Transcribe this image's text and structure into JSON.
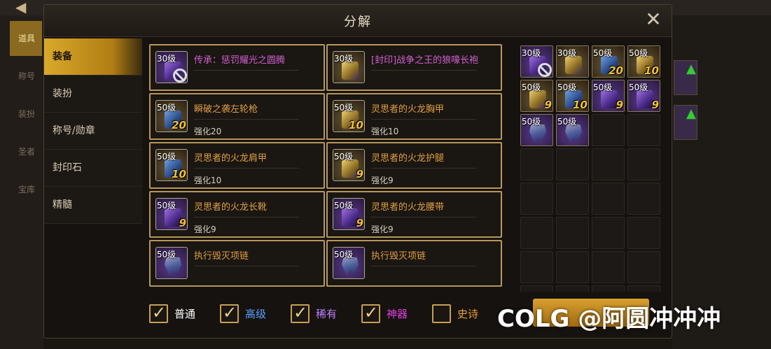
{
  "background": {
    "side_tabs": [
      "道具",
      "称号",
      "装扮",
      "圣者",
      "宝库"
    ]
  },
  "dialog": {
    "title": "分解",
    "close_label": "✕"
  },
  "categories": [
    {
      "label": "装备",
      "active": true
    },
    {
      "label": "装扮",
      "active": false
    },
    {
      "label": "称号/勋章",
      "active": false
    },
    {
      "label": "封印石",
      "active": false
    },
    {
      "label": "精髓",
      "active": false
    }
  ],
  "items": [
    {
      "level": "30级",
      "name": "传承：惩罚耀光之圆腾",
      "enhance": "",
      "badge": "",
      "rarity": "legend",
      "icon": "totem-icon",
      "banned": true
    },
    {
      "level": "30级",
      "name": "[封印]战争之王的狼嚎长袍",
      "enhance": "",
      "badge": "",
      "rarity": "legend",
      "icon": "robe-icon",
      "banned": false
    },
    {
      "level": "50级",
      "name": "瞬破之袭左轮枪",
      "enhance": "强化20",
      "badge": "20",
      "rarity": "rare",
      "icon": "revolver-icon",
      "banned": false
    },
    {
      "level": "50级",
      "name": "灵思者的火龙胸甲",
      "enhance": "强化10",
      "badge": "10",
      "rarity": "rare",
      "icon": "chest-armor-icon",
      "banned": false
    },
    {
      "level": "50级",
      "name": "灵思者的火龙肩甲",
      "enhance": "强化10",
      "badge": "10",
      "rarity": "rare",
      "icon": "shoulder-armor-icon",
      "banned": false
    },
    {
      "level": "50级",
      "name": "灵思者的火龙护腿",
      "enhance": "强化9",
      "badge": "9",
      "rarity": "rare",
      "icon": "leg-armor-icon",
      "banned": false
    },
    {
      "level": "50级",
      "name": "灵思者的火龙长靴",
      "enhance": "强化9",
      "badge": "9",
      "rarity": "rare",
      "icon": "boots-icon",
      "banned": false
    },
    {
      "level": "50级",
      "name": "灵思者的火龙腰带",
      "enhance": "强化9",
      "badge": "9",
      "rarity": "rare",
      "icon": "belt-icon",
      "banned": false
    },
    {
      "level": "50级",
      "name": "执行毁灭项链",
      "enhance": "",
      "badge": "",
      "rarity": "rare",
      "icon": "necklace-icon",
      "banned": false
    },
    {
      "level": "50级",
      "name": "执行毁灭项链",
      "enhance": "",
      "badge": "",
      "rarity": "rare",
      "icon": "necklace-icon",
      "banned": false
    }
  ],
  "slots": [
    {
      "level": "30级",
      "badge": "",
      "icon": "totem-icon",
      "banned": true
    },
    {
      "level": "30级",
      "badge": "",
      "icon": "robe-icon",
      "banned": false
    },
    {
      "level": "50级",
      "badge": "20",
      "icon": "revolver-icon",
      "banned": false
    },
    {
      "level": "50级",
      "badge": "10",
      "icon": "chest-armor-icon",
      "banned": false
    },
    {
      "level": "50级",
      "badge": "9",
      "icon": "leg-armor-icon",
      "banned": false
    },
    {
      "level": "50级",
      "badge": "10",
      "icon": "shoulder-armor-icon",
      "banned": false
    },
    {
      "level": "50级",
      "badge": "9",
      "icon": "boots-icon",
      "banned": false
    },
    {
      "level": "50级",
      "badge": "9",
      "icon": "belt-icon",
      "banned": false
    },
    {
      "level": "50级",
      "badge": "",
      "icon": "necklace-icon",
      "banned": false
    },
    {
      "level": "50级",
      "badge": "",
      "icon": "necklace-icon",
      "banned": false
    }
  ],
  "filters": [
    {
      "label": "普通",
      "checked": true,
      "color": "#ffffff"
    },
    {
      "label": "高级",
      "checked": true,
      "color": "#60a0ff"
    },
    {
      "label": "稀有",
      "checked": true,
      "color": "#c080ff"
    },
    {
      "label": "神器",
      "checked": true,
      "color": "#e040e0"
    },
    {
      "label": "史诗",
      "checked": false,
      "color": "#f0a030"
    }
  ],
  "watermark": "COLG @阿圆冲冲冲",
  "colors": {
    "accent_gold": "#d9a92a",
    "legend_name": "#d060d0",
    "rare_name": "#e0a040",
    "card_border": "#b8975a"
  }
}
